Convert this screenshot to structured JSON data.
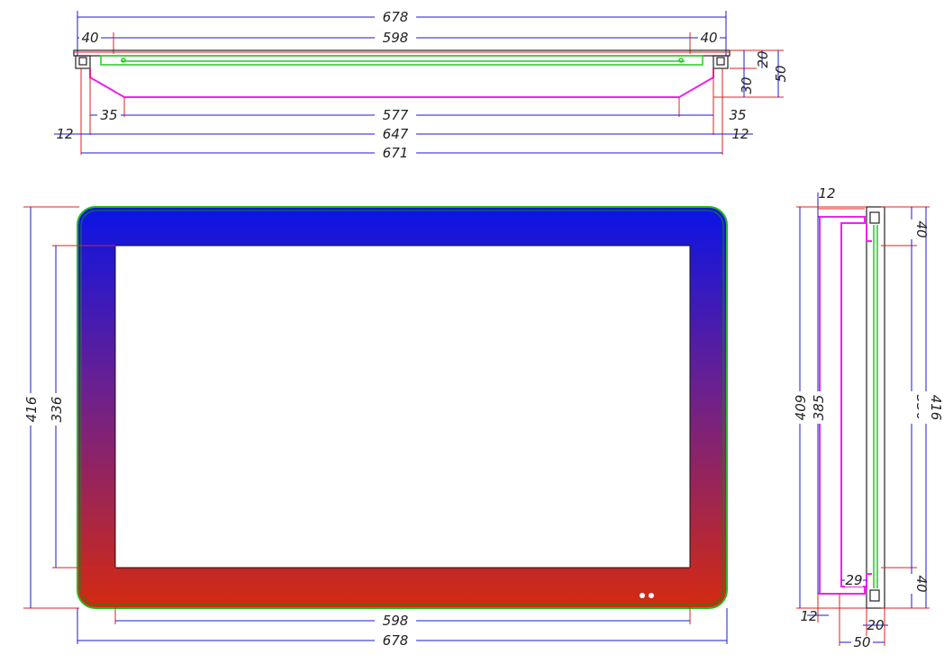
{
  "top_view": {
    "overall_width": "678",
    "left_margin": "40",
    "glass_width": "598",
    "right_margin": "40",
    "depth_a": "20",
    "depth_b": "30",
    "total_depth": "50",
    "left_chamfer": "35",
    "back_width": "577",
    "right_chamfer": "35",
    "left_lip": "12",
    "inner_width": "647",
    "right_lip": "12",
    "outer_width": "671"
  },
  "front_view": {
    "overall_height": "416",
    "viewable_height": "336",
    "viewable_width": "598",
    "overall_width": "678",
    "colors": {
      "top": "#0a14e6",
      "bottom": "#d42a10",
      "outline": "#22bb22"
    }
  },
  "side_view": {
    "top_lip": "12",
    "total_height_outer": "409",
    "total_height_inner": "385",
    "viewable_height": "336",
    "overall_height": "416",
    "top_border": "40",
    "bottom_border": "40",
    "bottom_offset": "29",
    "bottom_lip": "12",
    "front_depth": "20",
    "total_depth": "50"
  }
}
